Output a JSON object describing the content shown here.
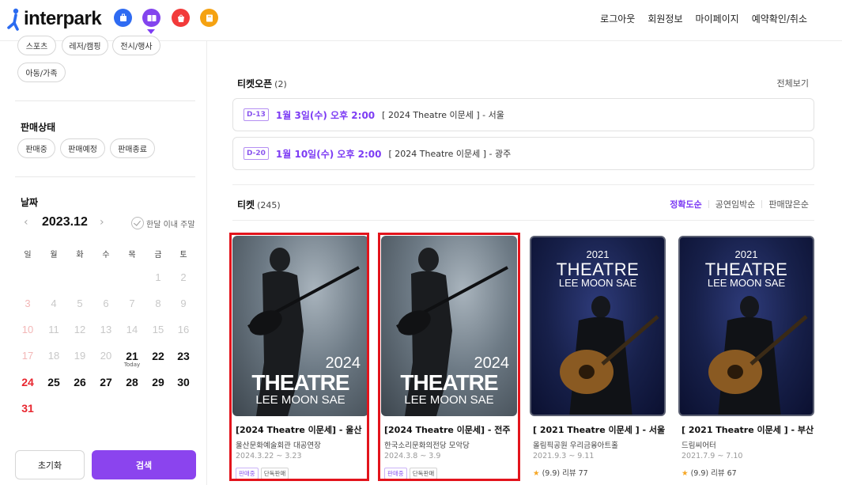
{
  "header": {
    "logo_text": "interpark",
    "nav": [
      "로그아웃",
      "회원정보",
      "마이페이지",
      "예약확인/취소"
    ],
    "service_icons": [
      {
        "icon": "tour-suitcase-icon",
        "color": "#2f6bf2"
      },
      {
        "icon": "ticket-icon",
        "color": "#8344ee",
        "active": true
      },
      {
        "icon": "shopping-bag-icon",
        "color": "#f23a3a"
      },
      {
        "icon": "book-icon",
        "color": "#f5a211"
      }
    ]
  },
  "sidebar": {
    "genre_chips": [
      "스포츠",
      "레저/캠핑",
      "전시/행사",
      "아동/가족"
    ],
    "status_title": "판매상태",
    "status_chips": [
      "판매중",
      "판매예정",
      "판매종료"
    ],
    "date_title": "날짜",
    "calendar": {
      "month": "2023.12",
      "within_month_label": "한달 이내 주말",
      "weekdays": [
        "일",
        "월",
        "화",
        "수",
        "목",
        "금",
        "토"
      ],
      "today_label": "Today",
      "today": 21
    },
    "reset_label": "초기화",
    "search_label": "검색"
  },
  "main": {
    "open_section": {
      "title": "티켓오픈",
      "count": "(2)",
      "see_all": "전체보기",
      "items": [
        {
          "dday": "D-13",
          "date": "1월 3일(수) 오후 2:00",
          "title": "[ 2024 Theatre 이문세 ] - 서울"
        },
        {
          "dday": "D-20",
          "date": "1월 10일(수) 오후 2:00",
          "title": "[ 2024 Theatre 이문세 ] - 광주"
        }
      ]
    },
    "ticket_section": {
      "title": "티켓",
      "count": "(245)",
      "sort_options": [
        "정확도순",
        "공연임박순",
        "판매많은순"
      ],
      "cards": [
        {
          "title": "[2024 Theatre 이문세]  - 울산",
          "venue": "울산문화예술회관 대공연장",
          "date": "2024.3.22 ~ 3.23",
          "tags": [
            "판매중",
            "단독판매"
          ],
          "poster_year": "2024",
          "poster_main": "THEATRE",
          "poster_sub": "LEE MOON SAE"
        },
        {
          "title": "[2024 Theatre 이문세]  - 전주",
          "venue": "한국소리문화의전당 모악당",
          "date": "2024.3.8 ~ 3.9",
          "tags": [
            "판매중",
            "단독판매"
          ],
          "poster_year": "2024",
          "poster_main": "THEATRE",
          "poster_sub": "LEE MOON SAE"
        },
        {
          "title": "[ 2021 Theatre 이문세 ] - 서울",
          "venue": "올림픽공원 우리금융아트홀",
          "date": "2021.9.3 ~ 9.11",
          "rating": "(9.9) 리뷰 77",
          "poster_year": "2021",
          "poster_main": "THEATRE",
          "poster_sub": "LEE MOON SAE"
        },
        {
          "title": "[ 2021 Theatre 이문세 ] - 부산",
          "venue": "드림씨어터",
          "date": "2021.7.9 ~ 7.10",
          "rating": "(9.9) 리뷰 67",
          "poster_year": "2021",
          "poster_main": "THEATRE",
          "poster_sub": "LEE MOON SAE"
        }
      ]
    }
  },
  "colors": {
    "accent": "#7d3cf4",
    "highlight": "#e3141c",
    "sunday": "#e8262f"
  }
}
